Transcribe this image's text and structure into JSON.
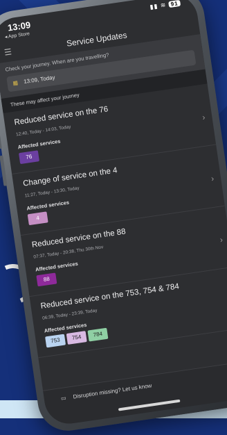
{
  "status_bar": {
    "time": "13:09",
    "back_label": "◂ App Store",
    "battery": "91"
  },
  "header": {
    "title": "Service Updates"
  },
  "journey": {
    "prompt": "Check your journey. When are you travelling?",
    "value": "13:09, Today"
  },
  "section_title": "These may affect your journey",
  "disruptions": [
    {
      "title": "Reduced service on the 76",
      "time": "12:40, Today - 14:03, Today",
      "affected_label": "Affected services",
      "services": [
        {
          "number": "76",
          "color": "#6b3fa0"
        }
      ]
    },
    {
      "title": "Change of service on the 4",
      "time": "11:27, Today - 13:30, Today",
      "affected_label": "Affected services",
      "services": [
        {
          "number": "4",
          "color": "#c58fc4"
        }
      ]
    },
    {
      "title": "Reduced service on the 88",
      "time": "07:37, Today - 20:38, Thu 30th Nov",
      "affected_label": "Affected services",
      "services": [
        {
          "number": "88",
          "color": "#8e2a9a"
        }
      ]
    },
    {
      "title": "Reduced service on the 753, 754 & 784",
      "time": "06:39, Today - 23:39, Today",
      "affected_label": "Affected services",
      "services": [
        {
          "number": "753",
          "color": "#b9d3f0"
        },
        {
          "number": "754",
          "color": "#d8b9e2"
        },
        {
          "number": "784",
          "color": "#8fd0a4"
        }
      ]
    }
  ],
  "footer": {
    "message": "Disruption missing? Let us know"
  }
}
